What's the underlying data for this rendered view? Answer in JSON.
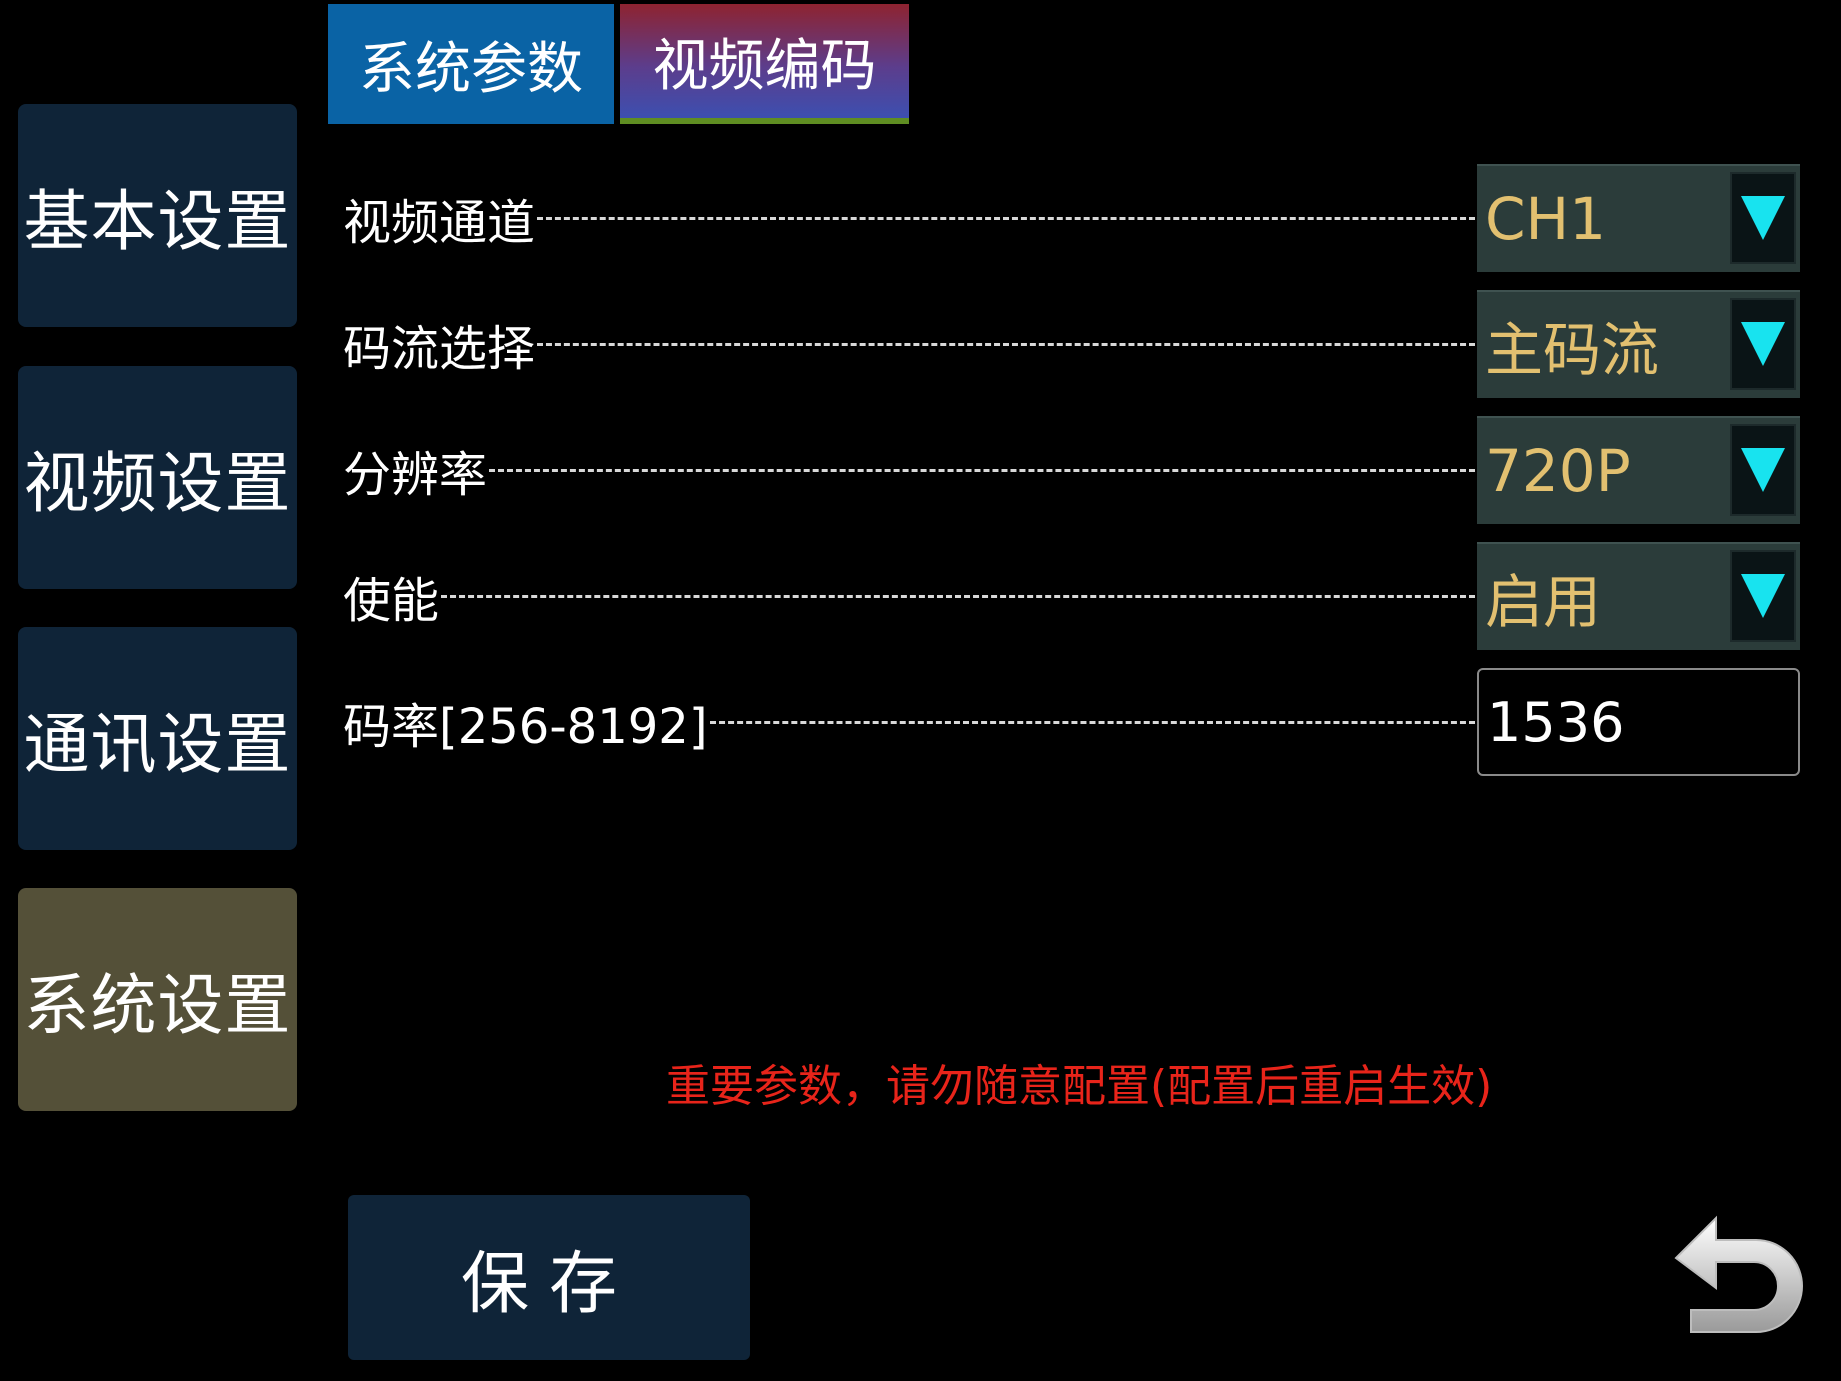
{
  "sidebar": {
    "items": [
      {
        "label": "基本设置"
      },
      {
        "label": "视频设置"
      },
      {
        "label": "通讯设置"
      },
      {
        "label": "系统设置"
      }
    ]
  },
  "tabs": [
    {
      "label": "系统参数"
    },
    {
      "label": "视频编码"
    }
  ],
  "fields": {
    "channel": {
      "label": "视频通道",
      "value": "CH1"
    },
    "stream": {
      "label": "码流选择",
      "value": "主码流"
    },
    "resolution": {
      "label": "分辨率",
      "value": "720P"
    },
    "enable": {
      "label": "使能",
      "value": "启用"
    },
    "bitrate": {
      "label": "码率[256-8192]",
      "value": "1536"
    }
  },
  "warning": "重要参数，请勿随意配置(配置后重启生效)",
  "save_label": "保存",
  "icons": {
    "dropdown": "triangle-down-icon",
    "back": "return-arrow-icon"
  },
  "colors": {
    "select_text": "#e2c070",
    "arrow": "#18e3ef",
    "warning": "#e8241a",
    "active_menu": "#545038"
  }
}
